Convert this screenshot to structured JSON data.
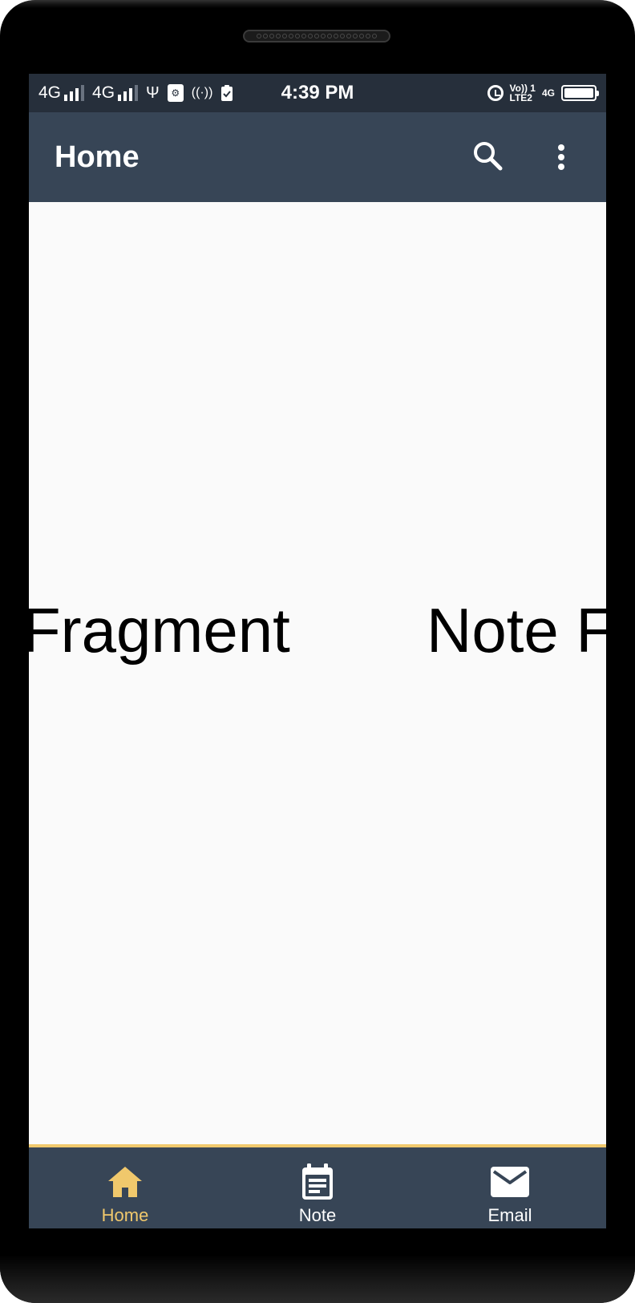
{
  "status_bar": {
    "net1": "4G",
    "net2": "4G",
    "time": "4:39 PM",
    "volte_top": "Vo)) 1",
    "volte_bottom": "LTE2",
    "net_small": "4G"
  },
  "app_bar": {
    "title": "Home",
    "search_icon": "search-icon",
    "menu_icon": "more-vert-icon"
  },
  "pager": {
    "left_page_text": "Fragment",
    "right_page_text": "Note F"
  },
  "bottom_nav": {
    "active_color": "#f0c86c",
    "items": [
      {
        "label": "Home",
        "icon": "home-icon",
        "active": true
      },
      {
        "label": "Note",
        "icon": "note-icon",
        "active": false
      },
      {
        "label": "Email",
        "icon": "email-icon",
        "active": false
      }
    ]
  },
  "system_nav": {
    "buttons": [
      "menu-icon",
      "home-icon",
      "back-icon"
    ]
  },
  "colors": {
    "status_bar": "#262f3b",
    "app_bar": "#374556",
    "accent": "#f0c86c",
    "background": "#fafafa"
  }
}
